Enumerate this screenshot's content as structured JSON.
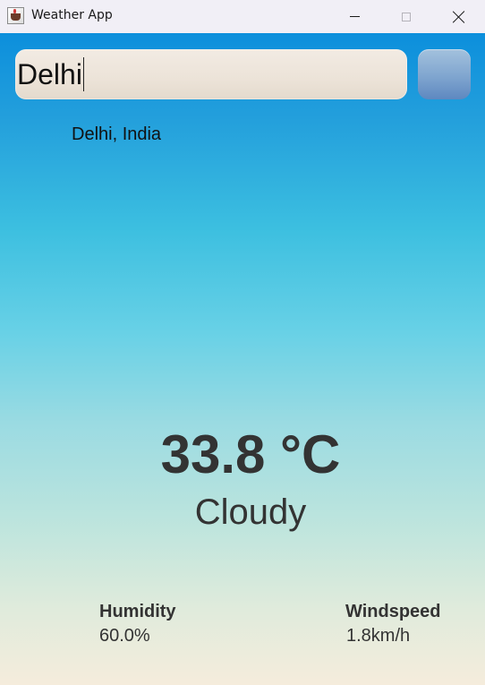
{
  "window": {
    "title": "Weather App",
    "icon": "coffee-cup-icon"
  },
  "titlebar_buttons": {
    "minimize": "minimize-icon",
    "maximize": "maximize-icon",
    "close": "close-icon"
  },
  "search": {
    "value": "Delhi",
    "button_icon": "search-icon"
  },
  "location": "Delhi, India",
  "current": {
    "temperature": "33.8 °C",
    "condition": "Cloudy",
    "condition_icon": "cloudy-icon"
  },
  "stats": {
    "humidity_label": "Humidity",
    "humidity_value": "60.0%",
    "windspeed_label": "Windspeed",
    "windspeed_value": "1.8km/h"
  },
  "colors": {
    "gradient_top": "#0c8fdc",
    "gradient_bottom": "#f5ecdc",
    "text": "#333333"
  }
}
